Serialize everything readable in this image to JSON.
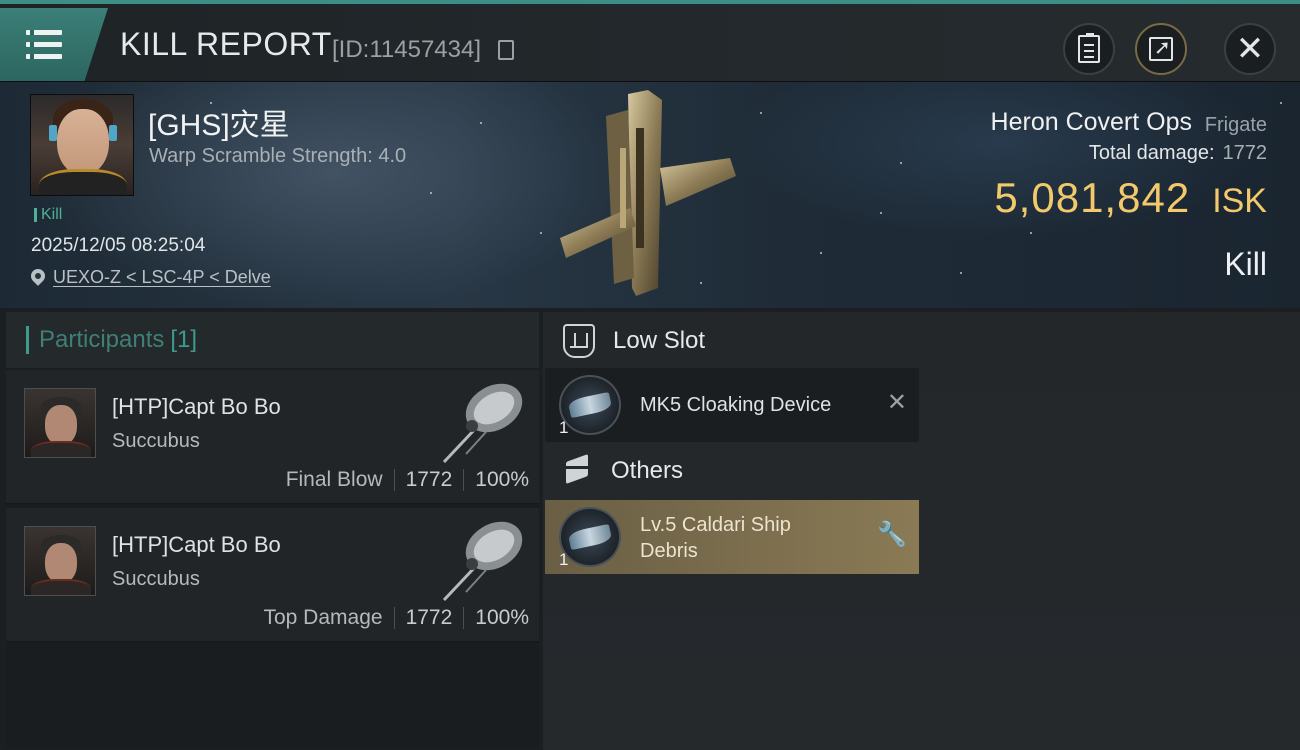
{
  "header": {
    "title": "KILL REPORT",
    "report_id": "[ID:11457434]"
  },
  "victim": {
    "name": "[GHS]灾星",
    "warp_scramble": "Warp Scramble Strength: 4.0",
    "tag": "Kill",
    "datetime": "2025/12/05 08:25:04",
    "location": "UEXO-Z < LSC-4P < Delve",
    "ship_name": "Heron Covert Ops",
    "ship_class": "Frigate",
    "total_damage_label": "Total damage:",
    "total_damage_value": "1772",
    "isk_value": "5,081,842",
    "isk_unit": "ISK",
    "status": "Kill"
  },
  "participants": {
    "label": "Participants",
    "count": "[1]",
    "items": [
      {
        "name": "[HTP]Capt Bo Bo",
        "ship": "Succubus",
        "role": "Final Blow",
        "damage": "1772",
        "percent": "100%"
      },
      {
        "name": "[HTP]Capt Bo Bo",
        "ship": "Succubus",
        "role": "Top Damage",
        "damage": "1772",
        "percent": "100%"
      }
    ]
  },
  "fitting": {
    "low_slot": {
      "title": "Low Slot",
      "items": [
        {
          "name": "MK5 Cloaking Device",
          "qty": "1"
        }
      ]
    },
    "others": {
      "title": "Others",
      "items": [
        {
          "name_line1": "Lv.5 Caldari Ship",
          "name_line2": "Debris",
          "qty": "1"
        }
      ]
    }
  },
  "colors": {
    "accent_teal": "#3d8f86",
    "isk_gold": "#f2c96b",
    "debris_highlight": "#8a7a55"
  },
  "icons": [
    "menu-icon",
    "copy-icon",
    "document-icon",
    "share-icon",
    "close-icon",
    "location-pin-icon",
    "low-slot-icon",
    "box-icon",
    "x-icon",
    "wrench-icon"
  ]
}
